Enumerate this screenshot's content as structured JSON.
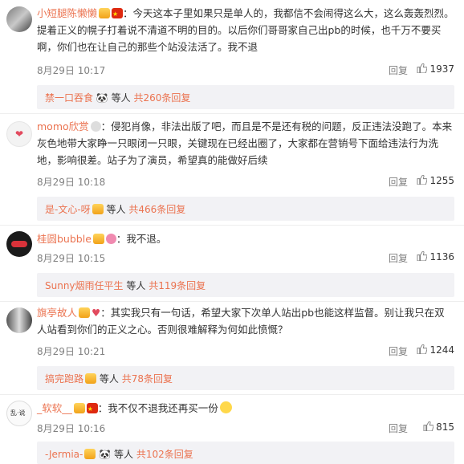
{
  "comments": [
    {
      "name": "小短腿陈懒懒",
      "text": "：今天这本子里如果只是单人的，我都信不会闹得这么大，这么轰轰烈烈。提着正义的幌子打着说不清道不明的目的。以后你们哥哥家自己出pb的时候，也千万不要买啊，你们也在让自己的那些个站没法活了。我不退",
      "time": "8月29日 10:17",
      "reply": "回复",
      "likes": "1937",
      "sub_name": "禁一口吞食",
      "sub_suffix": "等人",
      "sub_count": "共260条回复"
    },
    {
      "name": "momo欣赏",
      "text": "：侵犯肖像，非法出版了吧，而且是不是还有税的问题，反正违法没跑了。本来灰色地带大家睁一只眼闭一只眼，关键现在已经出圈了，大家都在营销号下面给违法行为洗地，影响很差。站子为了演员，希望真的能做好后续",
      "time": "8月29日 10:18",
      "reply": "回复",
      "likes": "1255",
      "sub_name": "是-文心-呀",
      "sub_suffix": "等人",
      "sub_count": "共466条回复"
    },
    {
      "name": "桂圆bubble",
      "text": "：我不退。",
      "time": "8月29日 10:15",
      "reply": "回复",
      "likes": "1136",
      "sub_name": "Sunny烟雨任平生",
      "sub_suffix": "等人",
      "sub_count": "共119条回复"
    },
    {
      "name": "旗亭故人",
      "text": "：其实我只有一句话，希望大家下次单人站出pb也能这样监督。别让我只在双人站看到你们的正义之心。否则很难解释为何如此愤慨？",
      "time": "8月29日 10:21",
      "reply": "回复",
      "likes": "1244",
      "sub_name": "搞完跑路",
      "sub_suffix": "等人",
      "sub_count": "共78条回复"
    },
    {
      "name": "_软软__",
      "text": "：我不仅不退我还再买一份",
      "time": "8月29日 10:16",
      "reply": "回复",
      "likes": "815",
      "sub_name": "-Jermia-",
      "sub_suffix": "等人",
      "sub_count": "共102条回复"
    }
  ],
  "colors": {
    "name": "#eb7350",
    "subbox_bg": "#f2f2f5",
    "meta": "#808080"
  },
  "icons": [
    "thumbs-up-icon",
    "vip-badge-icon",
    "china-flag-icon",
    "panda-emoji-icon",
    "smile-emoji-icon",
    "heart-emoji-icon"
  ]
}
